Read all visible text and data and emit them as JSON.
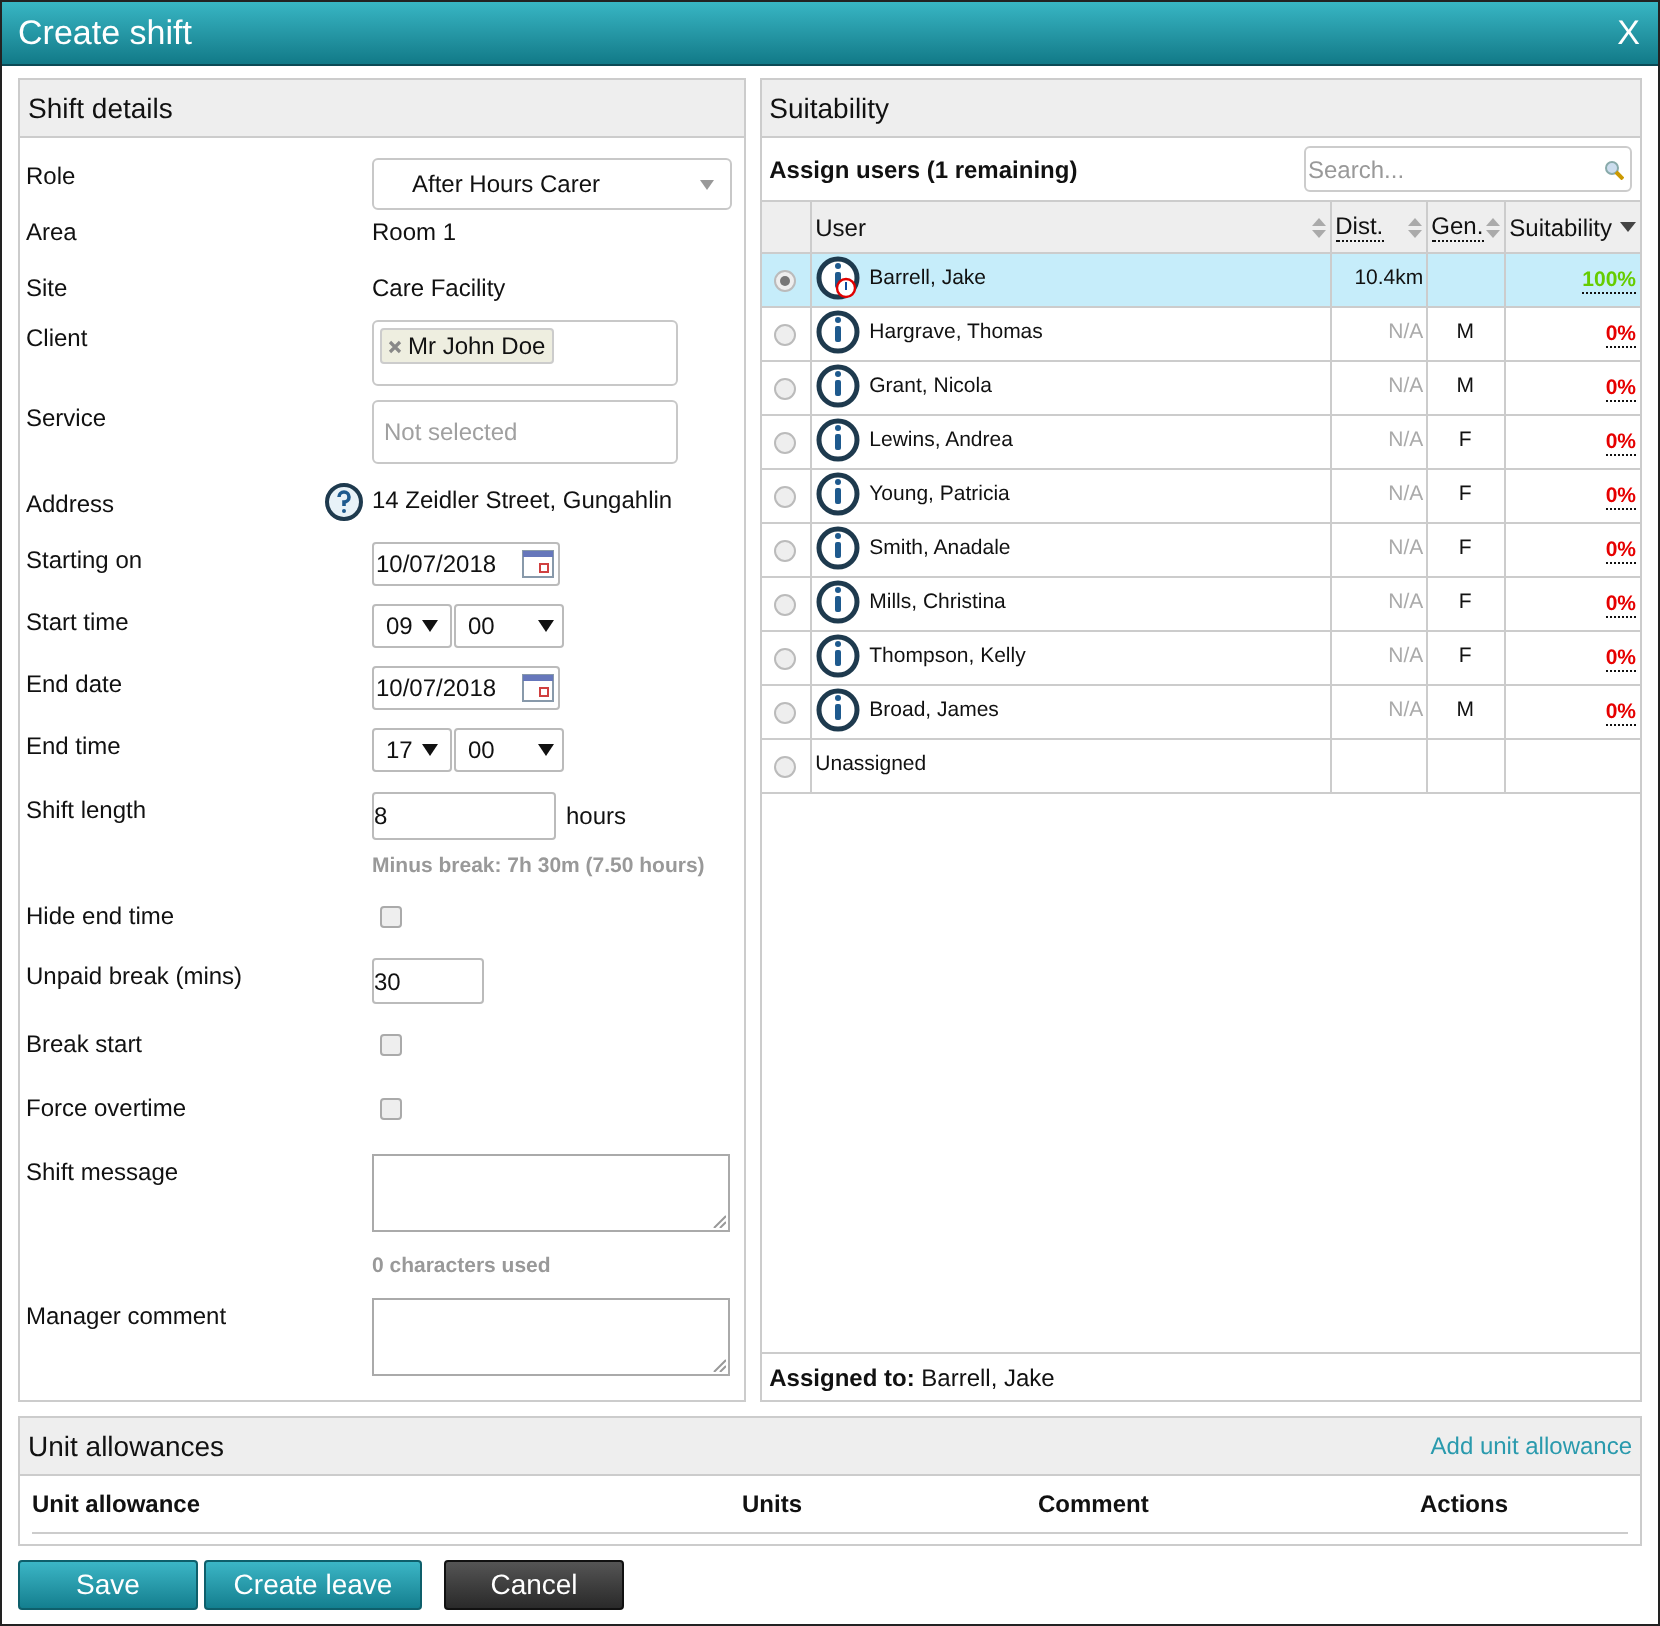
{
  "window": {
    "title": "Create shift",
    "close": "X"
  },
  "shift_details": {
    "title": "Shift details",
    "fields": [
      {
        "kind": "select",
        "label": "Role",
        "value": "After Hours Carer"
      },
      {
        "kind": "text",
        "label": "Area",
        "value": "Room 1"
      },
      {
        "kind": "text",
        "label": "Site",
        "value": "Care Facility"
      },
      {
        "kind": "chips",
        "label": "Client",
        "chips": [
          "Mr John Doe"
        ]
      },
      {
        "kind": "picker",
        "label": "Service",
        "placeholder": "Not selected"
      },
      {
        "kind": "address",
        "label": "Address",
        "value": "14 Zeidler Street, Gungahlin"
      },
      {
        "kind": "date",
        "label": "Starting on",
        "value": "10/07/2018"
      },
      {
        "kind": "time",
        "label": "Start time",
        "hour": "09",
        "minute": "00"
      },
      {
        "kind": "date",
        "label": "End date",
        "value": "10/07/2018"
      },
      {
        "kind": "time",
        "label": "End time",
        "hour": "17",
        "minute": "00"
      },
      {
        "kind": "number",
        "label": "Shift length",
        "value": "8",
        "suffix": "hours",
        "note": "Minus break: 7h 30m (7.50 hours)"
      },
      {
        "kind": "checkbox",
        "label": "Hide end time",
        "checked": false
      },
      {
        "kind": "short",
        "label": "Unpaid break (mins)",
        "value": "30"
      },
      {
        "kind": "checkbox",
        "label": "Break start",
        "checked": false
      },
      {
        "kind": "checkbox",
        "label": "Force overtime",
        "checked": false
      },
      {
        "kind": "textarea",
        "label": "Shift message",
        "note": "0 characters used"
      },
      {
        "kind": "textarea",
        "label": "Manager comment"
      }
    ]
  },
  "suitability": {
    "title": "Suitability",
    "assign_label": "Assign users (1 remaining)",
    "search": {
      "placeholder": "Search..."
    },
    "columns": [
      {
        "label": "User",
        "sorted": false,
        "dotted": false
      },
      {
        "label": "Dist.",
        "sorted": false,
        "dotted": true
      },
      {
        "label": "Gen.",
        "sorted": false,
        "dotted": true
      },
      {
        "label": "Suitability",
        "sorted": true,
        "dotted": false
      }
    ],
    "rows": [
      {
        "kind": "user",
        "selected": true,
        "warning": true,
        "name": "Barrell, Jake",
        "dist": "10.4km",
        "dist_known": true,
        "gender": "",
        "suitability": "100%",
        "color": "#66cc00"
      },
      {
        "kind": "user",
        "selected": false,
        "warning": false,
        "name": "Hargrave, Thomas",
        "dist": "N/A",
        "dist_known": false,
        "gender": "M",
        "suitability": "0%",
        "color": "#e60000"
      },
      {
        "kind": "user",
        "selected": false,
        "warning": false,
        "name": "Grant, Nicola",
        "dist": "N/A",
        "dist_known": false,
        "gender": "M",
        "suitability": "0%",
        "color": "#e60000"
      },
      {
        "kind": "user",
        "selected": false,
        "warning": false,
        "name": "Lewins, Andrea",
        "dist": "N/A",
        "dist_known": false,
        "gender": "F",
        "suitability": "0%",
        "color": "#e60000"
      },
      {
        "kind": "user",
        "selected": false,
        "warning": false,
        "name": "Young, Patricia",
        "dist": "N/A",
        "dist_known": false,
        "gender": "F",
        "suitability": "0%",
        "color": "#e60000"
      },
      {
        "kind": "user",
        "selected": false,
        "warning": false,
        "name": "Smith, Anadale",
        "dist": "N/A",
        "dist_known": false,
        "gender": "F",
        "suitability": "0%",
        "color": "#e60000"
      },
      {
        "kind": "user",
        "selected": false,
        "warning": false,
        "name": "Mills, Christina",
        "dist": "N/A",
        "dist_known": false,
        "gender": "F",
        "suitability": "0%",
        "color": "#e60000"
      },
      {
        "kind": "user",
        "selected": false,
        "warning": false,
        "name": "Thompson, Kelly",
        "dist": "N/A",
        "dist_known": false,
        "gender": "F",
        "suitability": "0%",
        "color": "#e60000"
      },
      {
        "kind": "user",
        "selected": false,
        "warning": false,
        "name": "Broad, James",
        "dist": "N/A",
        "dist_known": false,
        "gender": "M",
        "suitability": "0%",
        "color": "#e60000"
      },
      {
        "kind": "unassigned",
        "selected": false,
        "name": "Unassigned"
      }
    ],
    "assigned": "**Assigned to:** Barrell, Jake"
  },
  "unit_allowances": {
    "title": "Unit allowances",
    "add_link": "Add unit allowance",
    "columns": [
      "Unit allowance",
      "Units",
      "Comment",
      "Actions"
    ]
  },
  "buttons": [
    {
      "label": "Save",
      "kind": "primary"
    },
    {
      "label": "Create leave",
      "kind": "primary"
    },
    {
      "label": "Cancel",
      "kind": "dark"
    }
  ]
}
